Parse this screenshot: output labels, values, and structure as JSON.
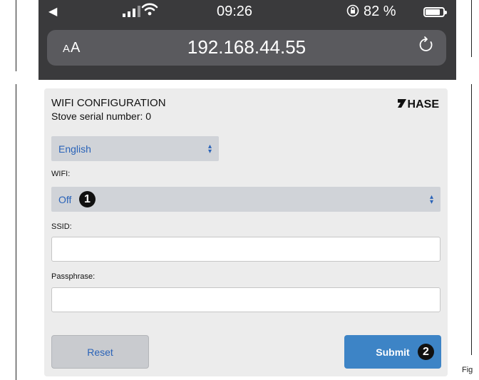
{
  "status_bar": {
    "back_glyph": "◀",
    "time": "09:26",
    "lock_icon": "rotation-lock-icon",
    "battery_percent": "82 %",
    "battery_level": 0.82
  },
  "address_bar": {
    "aa_big": "A",
    "aa_small": "A",
    "url": "192.168.44.55",
    "reload_icon": "reload-icon"
  },
  "form": {
    "title": "WIFI CONFIGURATION",
    "serial": "Stove serial number: 0",
    "logo_text": "HASE",
    "language_value": "English",
    "wifi_label": "WIFI:",
    "wifi_value": "Off",
    "ssid_label": "SSID:",
    "ssid_value": "",
    "passphrase_label": "Passphrase:",
    "passphrase_value": "",
    "reset_label": "Reset",
    "submit_label": "Submit",
    "accent_color": "#3d84c6",
    "link_color": "#2a63b8"
  },
  "annotations": {
    "marker_1": "1",
    "marker_2": "2",
    "fig_text": "Fig"
  }
}
